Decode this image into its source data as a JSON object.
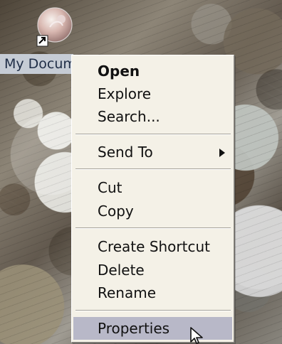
{
  "desktop": {
    "icon": {
      "name": "my-documents",
      "label": "My Docum"
    }
  },
  "context_menu": {
    "items": [
      {
        "label": "Open",
        "bold": true,
        "selected": false
      },
      {
        "label": "Explore",
        "bold": false,
        "selected": false
      },
      {
        "label": "Search...",
        "bold": false,
        "selected": false
      },
      {
        "label": "Send To",
        "bold": false,
        "selected": false,
        "submenu_icon": "chevron-right-icon"
      },
      {
        "label": "Cut",
        "bold": false,
        "selected": false
      },
      {
        "label": "Copy",
        "bold": false,
        "selected": false
      },
      {
        "label": "Create Shortcut",
        "bold": false,
        "selected": false
      },
      {
        "label": "Delete",
        "bold": false,
        "selected": false
      },
      {
        "label": "Rename",
        "bold": false,
        "selected": false
      },
      {
        "label": "Properties",
        "bold": false,
        "selected": true
      }
    ],
    "highlight_color": "#b8b8c8",
    "menu_background": "#f4f1e7"
  },
  "icons": {
    "desktop_icon": "my-documents-icon",
    "shortcut_badge": "shortcut-arrow-icon",
    "cursor": "mouse-pointer-icon"
  },
  "desktop_colors": {
    "label_background": "#c6ccd5",
    "label_text": "#1f2d46"
  }
}
